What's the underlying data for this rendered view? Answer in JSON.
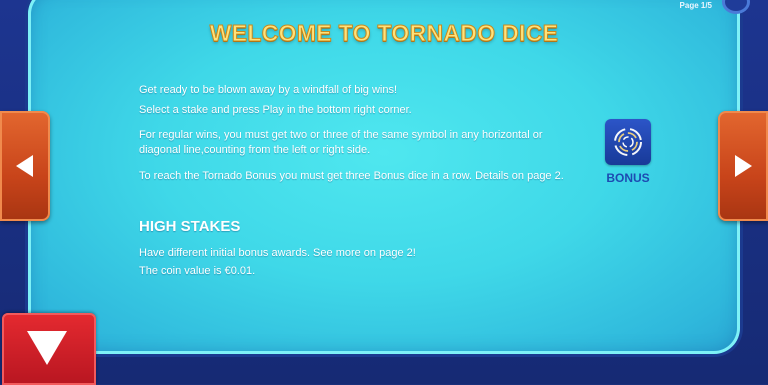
{
  "page_indicator": "Page  1/5",
  "title": "WELCOME TO TORNADO DICE",
  "intro": {
    "line1": "Get ready to be blown away by a windfall of big wins!",
    "line2": "Select a stake and press Play in the bottom right corner."
  },
  "regular_wins": {
    "line1": "For regular wins, you must get two or three of the same symbol in any horizontal or",
    "line2": "diagonal line,counting from the left or right side."
  },
  "bonus_info": "To reach the Tornado Bonus you must get three Bonus dice in a row. Details on page 2.",
  "bonus_symbol": {
    "label": "BONUS",
    "icon": "tornado-swirl-icon"
  },
  "high_stakes": {
    "title": "HIGH STAKES",
    "line1": "Have different initial bonus awards. See more on page 2!",
    "line2": "The coin value is €0.01."
  },
  "nav": {
    "prev_icon": "triangle-left-icon",
    "next_icon": "triangle-right-icon",
    "close_icon": "triangle-down-icon"
  },
  "colors": {
    "panel": "#3fd8e8",
    "title": "#ffe27a",
    "nav_button": "#d4521f",
    "down_button": "#d42028",
    "bonus_tile": "#2347ae"
  }
}
